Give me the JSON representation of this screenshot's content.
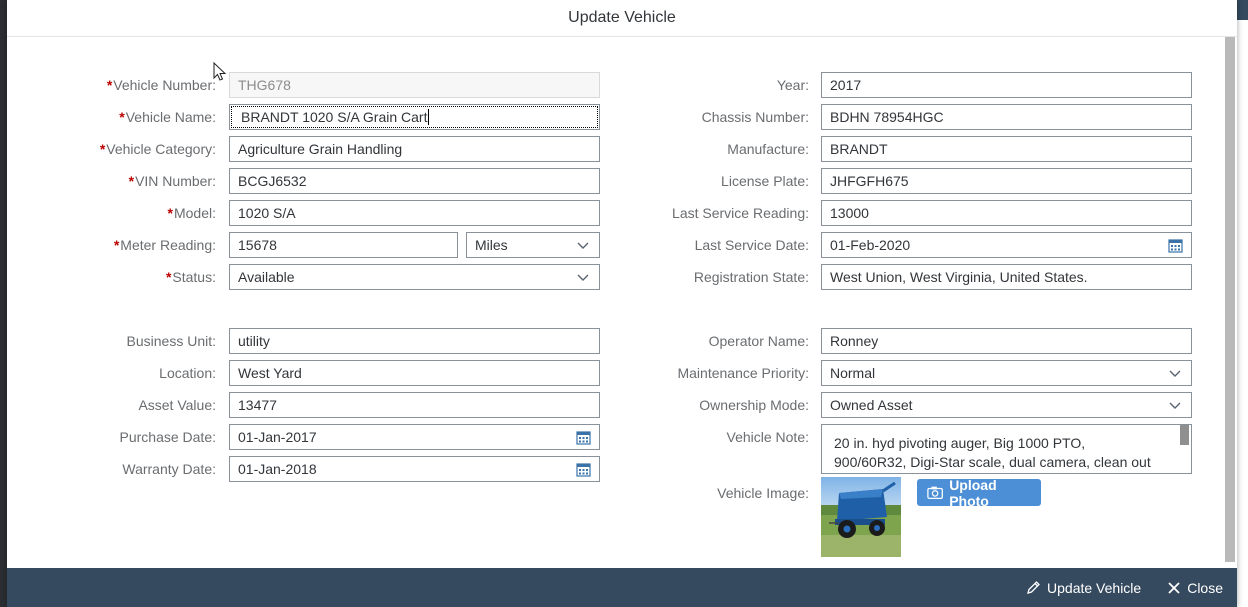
{
  "dialog": {
    "title": "Update Vehicle"
  },
  "left": {
    "vehicle_number": {
      "label": "Vehicle Number:",
      "value": "THG678",
      "required": true
    },
    "vehicle_name": {
      "label": "Vehicle Name:",
      "value": "BRANDT 1020 S/A Grain Cart",
      "required": true
    },
    "vehicle_category": {
      "label": "Vehicle Category:",
      "value": "Agriculture Grain Handling",
      "required": true
    },
    "vin_number": {
      "label": "VIN Number:",
      "value": "BCGJ6532",
      "required": true
    },
    "model": {
      "label": "Model:",
      "value": "1020 S/A",
      "required": true
    },
    "meter_reading": {
      "label": "Meter Reading:",
      "value": "15678",
      "unit": "Miles",
      "required": true
    },
    "status": {
      "label": "Status:",
      "value": "Available",
      "required": true
    },
    "business_unit": {
      "label": "Business Unit:",
      "value": "utility"
    },
    "location": {
      "label": "Location:",
      "value": "West Yard"
    },
    "asset_value": {
      "label": "Asset Value:",
      "value": "13477"
    },
    "purchase_date": {
      "label": "Purchase Date:",
      "value": "01-Jan-2017"
    },
    "warranty_date": {
      "label": "Warranty Date:",
      "value": "01-Jan-2018"
    }
  },
  "right": {
    "year": {
      "label": "Year:",
      "value": "2017"
    },
    "chassis_number": {
      "label": "Chassis Number:",
      "value": "BDHN 78954HGC"
    },
    "manufacture": {
      "label": "Manufacture:",
      "value": "BRANDT"
    },
    "license_plate": {
      "label": "License Plate:",
      "value": "JHFGFH675"
    },
    "last_service_reading": {
      "label": "Last Service Reading:",
      "value": "13000"
    },
    "last_service_date": {
      "label": "Last Service Date:",
      "value": "01-Feb-2020"
    },
    "registration_state": {
      "label": "Registration State:",
      "value": "West Union, West Virginia, United States."
    },
    "operator_name": {
      "label": "Operator Name:",
      "value": "Ronney"
    },
    "maintenance_priority": {
      "label": "Maintenance Priority:",
      "value": "Normal"
    },
    "ownership_mode": {
      "label": "Ownership Mode:",
      "value": "Owned Asset"
    },
    "vehicle_note": {
      "label": "Vehicle Note:",
      "value": "20 in. hyd pivoting auger, Big 1000 PTO, 900/60R32, Digi-Star scale, dual camera, clean out doors, roll"
    },
    "vehicle_image": {
      "label": "Vehicle Image:",
      "upload_label": "Upload Photo"
    }
  },
  "footer": {
    "update_label": "Update Vehicle",
    "close_label": "Close"
  },
  "icons": {
    "dropdown": "chevron-down-icon",
    "calendar": "calendar-icon",
    "edit": "pencil-icon",
    "close": "close-icon",
    "camera": "camera-icon"
  },
  "colors": {
    "accent": "#4d8fd6",
    "footer": "#354a5f",
    "required": "#bb0000",
    "label": "#6a6d70"
  }
}
